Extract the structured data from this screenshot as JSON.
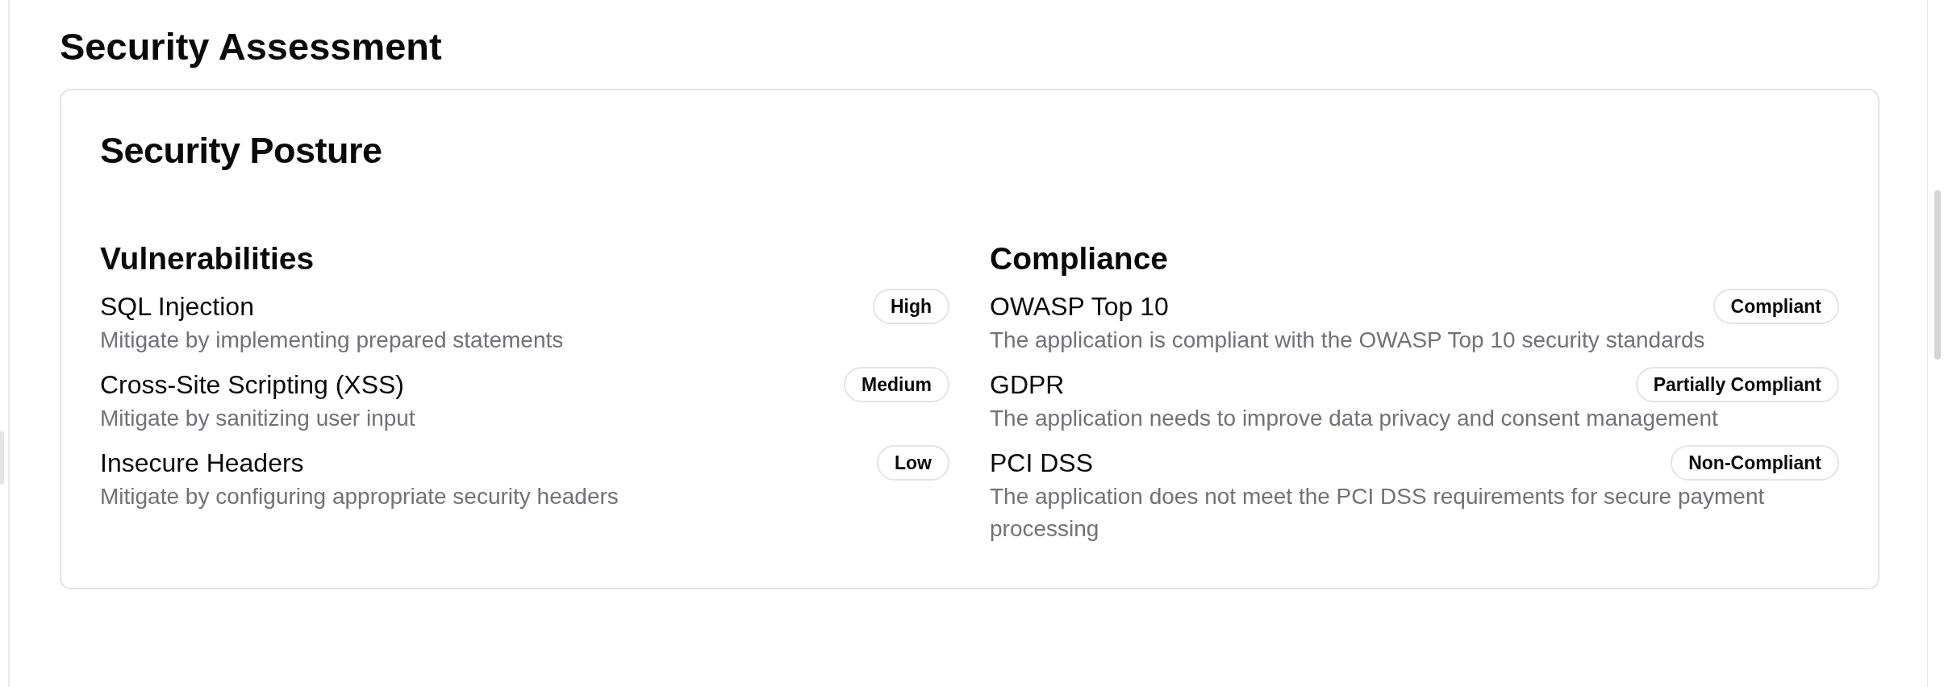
{
  "page_title": "Security Assessment",
  "card": {
    "title": "Security Posture",
    "sections": [
      {
        "heading": "Vulnerabilities",
        "items": [
          {
            "name": "SQL Injection",
            "badge": "High",
            "description": "Mitigate by implementing prepared statements"
          },
          {
            "name": "Cross-Site Scripting (XSS)",
            "badge": "Medium",
            "description": "Mitigate by sanitizing user input"
          },
          {
            "name": "Insecure Headers",
            "badge": "Low",
            "description": "Mitigate by configuring appropriate security headers"
          }
        ]
      },
      {
        "heading": "Compliance",
        "items": [
          {
            "name": "OWASP Top 10",
            "badge": "Compliant",
            "description": "The application is compliant with the OWASP Top 10 security standards"
          },
          {
            "name": "GDPR",
            "badge": "Partially Compliant",
            "description": "The application needs to improve data privacy and consent management"
          },
          {
            "name": "PCI DSS",
            "badge": "Non-Compliant",
            "description": "The application does not meet the PCI DSS requirements for secure payment processing"
          }
        ]
      }
    ]
  }
}
